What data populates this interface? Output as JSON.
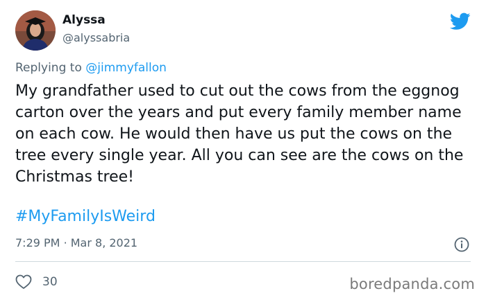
{
  "author": {
    "name": "Alyssa",
    "handle": "@alyssabria"
  },
  "icons": {
    "brand": "twitter-bird-icon",
    "info": "info-icon",
    "like": "heart-icon"
  },
  "reply": {
    "prefix": "Replying to",
    "mention": "@jimmyfallon"
  },
  "tweet": {
    "text": "My grandfather used to cut out the cows from the eggnog carton over the years and put every family member name on each cow. He would then have us put the cows on the tree every single year. All you can see are the cows on the Christmas tree!",
    "hashtag": "#MyFamilyIsWeird",
    "time": "7:29 PM",
    "separator": "·",
    "date": "Mar 8, 2021",
    "likes": "30"
  },
  "watermark": "boredpanda.com",
  "colors": {
    "accent": "#1d9bf0",
    "text": "#0f1419",
    "muted": "#536471"
  }
}
